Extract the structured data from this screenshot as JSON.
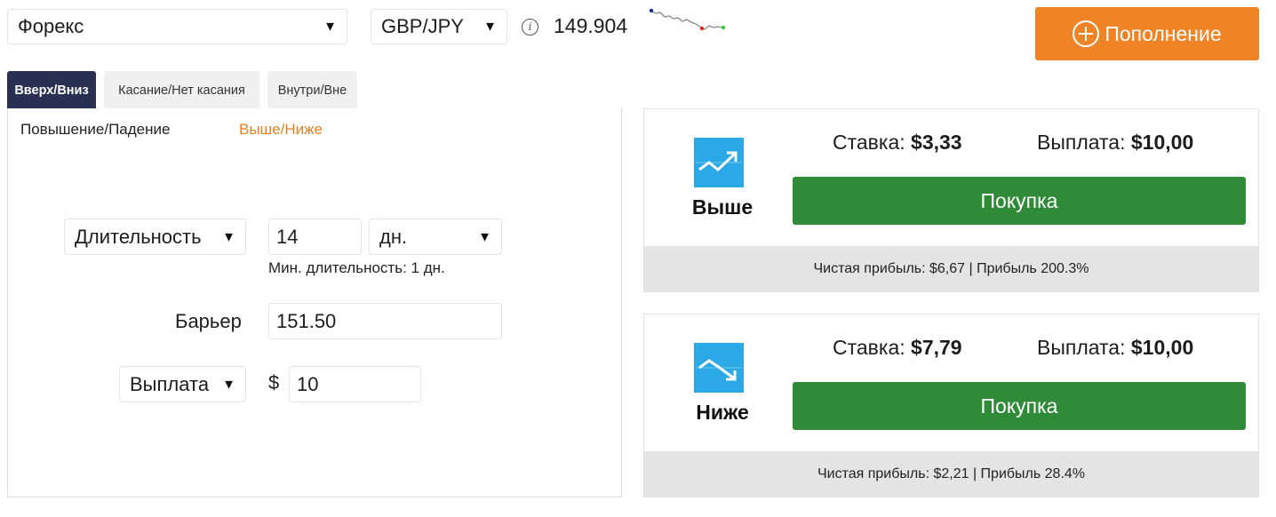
{
  "header": {
    "market_select": "Форекс",
    "asset_select": "GBP/JPY",
    "spot_price": "149.904",
    "deposit_label": "Пополнение"
  },
  "tabs": [
    {
      "label": "Вверх/Вниз",
      "active": true
    },
    {
      "label": "Касание/Нет касания",
      "active": false
    },
    {
      "label": "Внутри/Вне",
      "active": false
    }
  ],
  "subtabs": [
    {
      "label": "Повышение/Падение",
      "active": false
    },
    {
      "label": "Выше/Ниже",
      "active": true
    }
  ],
  "form": {
    "duration_select": "Длительность",
    "duration_value": "14",
    "duration_unit": "дн.",
    "min_duration_hint": "Мин. длительность: 1 дн.",
    "barrier_label": "Барьер",
    "barrier_value": "151.50",
    "amount_type_select": "Выплата",
    "currency_symbol": "$",
    "amount_value": "10"
  },
  "contracts": [
    {
      "direction": "Выше",
      "icon": "trend-up-icon",
      "stake_label": "Ставка:",
      "stake_value": "$3,33",
      "payout_label": "Выплата:",
      "payout_value": "$10,00",
      "buy_label": "Покупка",
      "footer": "Чистая прибыль: $6,67 | Прибыль 200.3%"
    },
    {
      "direction": "Ниже",
      "icon": "trend-down-icon",
      "stake_label": "Ставка:",
      "stake_value": "$7,79",
      "payout_label": "Выплата:",
      "payout_value": "$10,00",
      "buy_label": "Покупка",
      "footer": "Чистая прибыль: $2,21 | Прибыль 28.4%"
    }
  ],
  "colors": {
    "accent_orange": "#ef8427",
    "active_tab": "#2a3052",
    "buy_green": "#2f8b38",
    "icon_blue": "#2aa9e6"
  }
}
